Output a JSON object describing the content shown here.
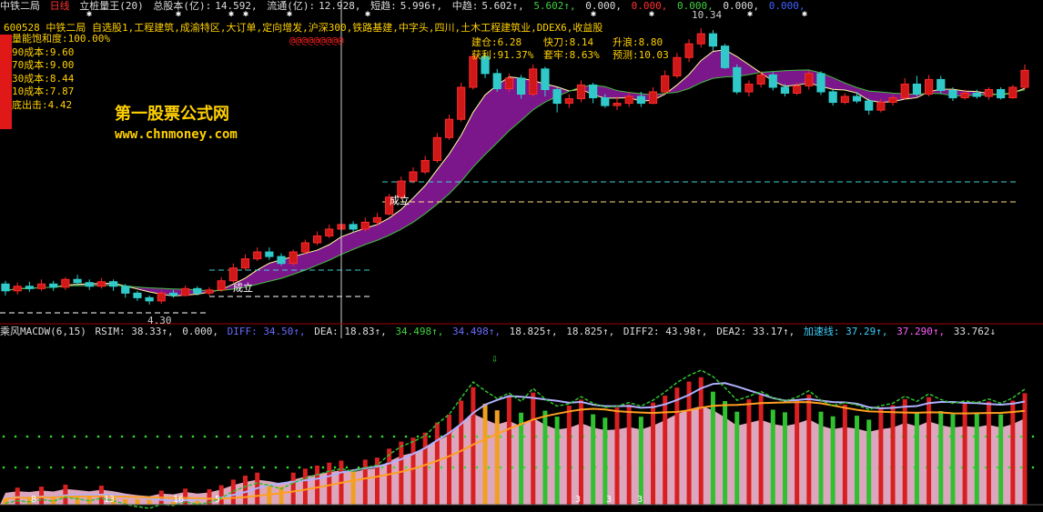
{
  "header": {
    "stock_name": "中铁二局",
    "period": "日线",
    "indicator": "立桩量王(20)",
    "total_shares_label": "总股本(亿):",
    "total_shares_value": "14.592,",
    "float_label": "流通(亿):",
    "float_value": "12.928,",
    "short_label": "短趋:",
    "short_value": "5.996↑,",
    "mid_label": "中趋:",
    "mid_value": "5.602↑,",
    "v1": "5.602↑,",
    "v2": "0.000,",
    "v3": "0.000,",
    "v4": "0.000,",
    "v5": "0.000,",
    "v6": "0.000,"
  },
  "tags_line": "600528 中铁二局 自选股1,工程建筑,成渝特区,大订单,定向增发,沪深300,铁路基建,中字头,四川,土木工程建筑业,DDEX6,收益股",
  "red_note": "@@@@@@@@@",
  "cost_box": [
    "量能饱和度:100.00%",
    "90成本:9.60",
    "70成本:9.00",
    "30成本:8.44",
    "10成本:7.87",
    "底出击:4.42"
  ],
  "stats": {
    "build": "建仓:6.28",
    "knife": "快刀:8.14",
    "rise": "升浪:8.80",
    "profit": "获利:91.37%",
    "trap": "套牢:8.63%",
    "predict": "预测:10.03"
  },
  "watermark": {
    "title": "第一股票公式网",
    "url": "www.chnmoney.com"
  },
  "annotations": {
    "high": "10.34",
    "low": "4.30",
    "chengli1": "成立",
    "chengli2": "成立"
  },
  "macd_header": [
    {
      "text": "乘风MACDW(6,15)",
      "color": "#dddddd"
    },
    {
      "text": "RSIM: 38.33↑,",
      "color": "#dddddd"
    },
    {
      "text": "0.000,",
      "color": "#dddddd"
    },
    {
      "text": "DIFF: 34.50↑,",
      "color": "#6a6aff"
    },
    {
      "text": "DEA: 18.83↑,",
      "color": "#dddddd"
    },
    {
      "text": "34.498↑,",
      "color": "#40d040"
    },
    {
      "text": "34.498↑,",
      "color": "#6a6aff"
    },
    {
      "text": "18.825↑,",
      "color": "#dddddd"
    },
    {
      "text": "18.825↑,",
      "color": "#dddddd"
    },
    {
      "text": "DIFF2: 43.98↑,",
      "color": "#dddddd"
    },
    {
      "text": "DEA2: 33.17↑,",
      "color": "#dddddd"
    },
    {
      "text": "加速线: 37.29↑,",
      "color": "#40d0ff"
    },
    {
      "text": "37.290↑,",
      "color": "#ff60ff"
    },
    {
      "text": "33.762↓",
      "color": "#dddddd"
    }
  ],
  "macd_labels": [
    "8",
    "13",
    "16",
    "5",
    "3",
    "3",
    "3"
  ],
  "chart_data": {
    "type": "candlestick",
    "ylim": [
      4.0,
      10.6
    ],
    "candles": [
      [
        4.75,
        4.6,
        4.82,
        4.5
      ],
      [
        4.6,
        4.7,
        4.78,
        4.52
      ],
      [
        4.7,
        4.65,
        4.8,
        4.58
      ],
      [
        4.65,
        4.75,
        4.85,
        4.6
      ],
      [
        4.75,
        4.68,
        4.82,
        4.6
      ],
      [
        4.68,
        4.85,
        4.9,
        4.62
      ],
      [
        4.85,
        4.78,
        4.95,
        4.72
      ],
      [
        4.78,
        4.7,
        4.85,
        4.62
      ],
      [
        4.7,
        4.8,
        4.88,
        4.65
      ],
      [
        4.8,
        4.7,
        4.85,
        4.6
      ],
      [
        4.7,
        4.55,
        4.75,
        4.45
      ],
      [
        4.55,
        4.45,
        4.6,
        4.38
      ],
      [
        4.45,
        4.38,
        4.5,
        4.3
      ],
      [
        4.38,
        4.55,
        4.6,
        4.32
      ],
      [
        4.55,
        4.5,
        4.62,
        4.45
      ],
      [
        4.5,
        4.65,
        4.72,
        4.48
      ],
      [
        4.65,
        4.55,
        4.7,
        4.5
      ],
      [
        4.55,
        4.62,
        4.68,
        4.5
      ],
      [
        4.62,
        4.82,
        4.9,
        4.58
      ],
      [
        4.82,
        5.1,
        5.2,
        4.78
      ],
      [
        5.1,
        5.3,
        5.4,
        5.05
      ],
      [
        5.3,
        5.45,
        5.55,
        5.25
      ],
      [
        5.45,
        5.35,
        5.55,
        5.28
      ],
      [
        5.35,
        5.2,
        5.42,
        5.15
      ],
      [
        5.2,
        5.45,
        5.5,
        5.15
      ],
      [
        5.45,
        5.65,
        5.72,
        5.4
      ],
      [
        5.65,
        5.8,
        5.9,
        5.6
      ],
      [
        5.8,
        5.95,
        6.05,
        5.75
      ],
      [
        5.95,
        6.05,
        6.15,
        5.9
      ],
      [
        6.05,
        5.95,
        6.12,
        5.88
      ],
      [
        5.95,
        6.1,
        6.2,
        5.9
      ],
      [
        6.1,
        6.2,
        6.3,
        6.02
      ],
      [
        6.28,
        6.65,
        6.72,
        6.25
      ],
      [
        6.65,
        7.0,
        7.1,
        6.6
      ],
      [
        7.0,
        7.2,
        7.3,
        6.95
      ],
      [
        7.2,
        7.45,
        7.55,
        7.15
      ],
      [
        7.45,
        7.95,
        8.05,
        7.4
      ],
      [
        7.95,
        8.35,
        8.45,
        7.9
      ],
      [
        8.35,
        9.05,
        9.15,
        8.3
      ],
      [
        9.05,
        9.72,
        9.8,
        9.0
      ],
      [
        9.72,
        9.35,
        9.8,
        9.25
      ],
      [
        9.35,
        9.02,
        9.45,
        8.95
      ],
      [
        9.02,
        9.25,
        9.35,
        8.95
      ],
      [
        9.25,
        8.9,
        9.32,
        8.8
      ],
      [
        8.9,
        9.45,
        9.55,
        8.85
      ],
      [
        9.45,
        9.0,
        9.5,
        8.85
      ],
      [
        9.0,
        8.7,
        9.05,
        8.5
      ],
      [
        8.7,
        8.8,
        8.9,
        8.6
      ],
      [
        8.8,
        9.1,
        9.2,
        8.72
      ],
      [
        9.1,
        8.82,
        9.15,
        8.7
      ],
      [
        8.82,
        8.65,
        8.9,
        8.6
      ],
      [
        8.65,
        8.7,
        8.85,
        8.55
      ],
      [
        8.7,
        8.85,
        8.95,
        8.62
      ],
      [
        8.85,
        8.7,
        8.95,
        8.62
      ],
      [
        8.7,
        8.95,
        9.05,
        8.68
      ],
      [
        8.95,
        9.3,
        9.42,
        8.9
      ],
      [
        9.3,
        9.7,
        9.8,
        9.25
      ],
      [
        9.7,
        10.0,
        10.1,
        9.6
      ],
      [
        10.0,
        10.22,
        10.34,
        9.92
      ],
      [
        10.22,
        9.95,
        10.3,
        9.85
      ],
      [
        9.95,
        9.48,
        10.0,
        9.45
      ],
      [
        9.48,
        8.95,
        9.55,
        8.9
      ],
      [
        8.95,
        9.12,
        9.2,
        8.85
      ],
      [
        9.12,
        9.32,
        9.4,
        9.05
      ],
      [
        9.32,
        9.05,
        9.38,
        8.98
      ],
      [
        9.05,
        8.92,
        9.12,
        8.85
      ],
      [
        8.92,
        9.08,
        9.15,
        8.88
      ],
      [
        9.08,
        9.35,
        9.42,
        9.0
      ],
      [
        9.35,
        8.95,
        9.4,
        8.88
      ],
      [
        8.95,
        8.72,
        9.0,
        8.65
      ],
      [
        8.72,
        8.85,
        8.92,
        8.68
      ],
      [
        8.85,
        8.75,
        8.95,
        8.7
      ],
      [
        8.75,
        8.55,
        8.8,
        8.45
      ],
      [
        8.55,
        8.72,
        8.8,
        8.5
      ],
      [
        8.72,
        8.82,
        8.88,
        8.65
      ],
      [
        8.82,
        9.12,
        9.25,
        8.78
      ],
      [
        9.12,
        8.9,
        9.3,
        8.85
      ],
      [
        8.9,
        9.22,
        9.32,
        8.85
      ],
      [
        9.22,
        8.98,
        9.3,
        8.9
      ],
      [
        8.98,
        8.82,
        9.05,
        8.75
      ],
      [
        8.82,
        8.92,
        9.0,
        8.78
      ],
      [
        8.92,
        8.85,
        9.0,
        8.8
      ],
      [
        8.85,
        9.0,
        9.05,
        8.78
      ],
      [
        9.0,
        8.82,
        9.05,
        8.78
      ],
      [
        8.82,
        9.05,
        9.1,
        8.8
      ],
      [
        9.05,
        9.42,
        9.55,
        9.0
      ]
    ]
  }
}
